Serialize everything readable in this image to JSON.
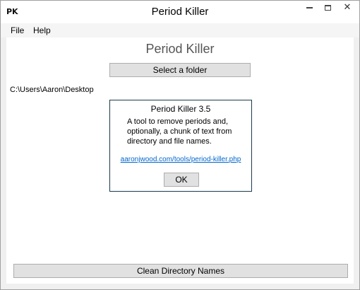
{
  "window": {
    "icon_text": "PK",
    "title": "Period Killer"
  },
  "menu": {
    "file": "File",
    "help": "Help"
  },
  "main": {
    "heading": "Period Killer",
    "select_folder_label": "Select a folder",
    "path": "C:\\Users\\Aaron\\Desktop",
    "clean_label": "Clean Directory Names"
  },
  "about": {
    "title": "Period Killer 3.5",
    "description": "A tool to remove periods and, optionally, a chunk of text from directory and file names.",
    "link": "aaronjwood.com/tools/period-killer.php",
    "ok_label": "OK"
  },
  "icons": {
    "minimize": "minimize-icon",
    "maximize": "maximize-icon",
    "close": "close-icon"
  }
}
